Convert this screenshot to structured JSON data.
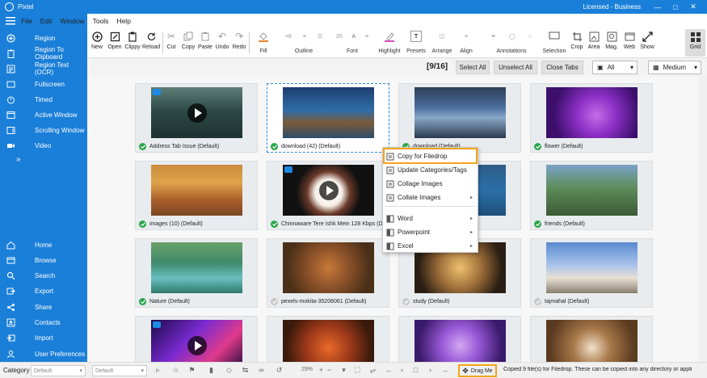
{
  "app": {
    "title": "Pixtel",
    "license": "Licensed - Business"
  },
  "colors": {
    "brand": "#1a7fd8",
    "check": "#2ba44a",
    "highlight": "#f5a31a"
  },
  "menu": [
    "File",
    "Edit",
    "Window",
    "Tools",
    "Help"
  ],
  "sidebar": {
    "capture": [
      {
        "label": "Region",
        "icon": "region-icon"
      },
      {
        "label": "Region To Clipboard",
        "icon": "clipboard-icon"
      },
      {
        "label": "Region Text (OCR)",
        "icon": "ocr-icon"
      },
      {
        "label": "Fullscreen",
        "icon": "fullscreen-icon"
      },
      {
        "label": "Timed",
        "icon": "timer-icon"
      },
      {
        "label": "Active Window",
        "icon": "window-icon"
      },
      {
        "label": "Scrolling Window",
        "icon": "scroll-window-icon"
      },
      {
        "label": "Video",
        "icon": "video-icon"
      }
    ],
    "more": "»",
    "nav": [
      {
        "label": "Home",
        "icon": "home-icon"
      },
      {
        "label": "Browse",
        "icon": "browse-icon"
      },
      {
        "label": "Search",
        "icon": "search-icon"
      },
      {
        "label": "Export",
        "icon": "export-icon"
      },
      {
        "label": "Share",
        "icon": "share-icon"
      },
      {
        "label": "Contacts",
        "icon": "contacts-icon"
      },
      {
        "label": "Import",
        "icon": "import-icon"
      },
      {
        "label": "User Preferences",
        "icon": "preferences-icon"
      }
    ]
  },
  "toolbar": {
    "buttons": [
      "New",
      "Open",
      "Clippy",
      "Reload",
      "Cut",
      "Copy",
      "Paste",
      "Undo",
      "Redo",
      "Fill",
      "Outline",
      "Font",
      "Highlight",
      "Presets",
      "Arrange",
      "Align",
      "Annotations",
      "Selection",
      "Crop",
      "Area",
      "Mag.",
      "Web",
      "Show",
      "Grid"
    ],
    "outline_value": "6",
    "font_size": "20"
  },
  "subbar": {
    "counter": "[9/16]",
    "select_all": "Select All",
    "unselect_all": "Unselect All",
    "close_tabs": "Close Tabs",
    "filter": "All",
    "size": "Medium"
  },
  "cards": [
    {
      "caption": "Address Tab Issue (Default)",
      "checked": true,
      "video": true,
      "theme": "forest"
    },
    {
      "caption": "download (42) (Default)",
      "checked": true,
      "video": false,
      "theme": "pier"
    },
    {
      "caption": "download (Default)",
      "checked": true,
      "video": false,
      "theme": "rain"
    },
    {
      "caption": "flower (Default)",
      "checked": true,
      "video": false,
      "theme": "flower"
    },
    {
      "caption": "images (10) (Default)",
      "checked": true,
      "video": false,
      "theme": "family"
    },
    {
      "caption": "Chinnaware Tere Ishk Mein 128 Kbps (Default)",
      "checked": true,
      "video": true,
      "theme": "music"
    },
    {
      "caption": "",
      "checked": true,
      "video": false,
      "theme": "ocean"
    },
    {
      "caption": "friends (Default)",
      "checked": true,
      "video": false,
      "theme": "friends"
    },
    {
      "caption": "Nature (Default)",
      "checked": true,
      "video": false,
      "theme": "waterfall"
    },
    {
      "caption": "pexels-mokita-35206061 (Default)",
      "checked": false,
      "video": false,
      "theme": "squirrel"
    },
    {
      "caption": "study (Default)",
      "checked": false,
      "video": false,
      "theme": "study"
    },
    {
      "caption": "tajmahal (Default)",
      "checked": false,
      "video": false,
      "theme": "taj"
    },
    {
      "caption": "",
      "checked": false,
      "video": true,
      "theme": "neon"
    },
    {
      "caption": "",
      "checked": false,
      "video": false,
      "theme": "fruit"
    },
    {
      "caption": "",
      "checked": false,
      "video": false,
      "theme": "butterfly"
    },
    {
      "caption": "",
      "checked": false,
      "video": false,
      "theme": "coffee"
    }
  ],
  "context_menu": [
    {
      "label": "Copy for Filedrop",
      "submenu": false
    },
    {
      "label": "Update Categories/Tags",
      "submenu": false
    },
    {
      "label": "Collage Images",
      "submenu": false
    },
    {
      "label": "Collate Images",
      "submenu": true
    },
    {
      "label": "Word",
      "submenu": true
    },
    {
      "label": "Powerpoint",
      "submenu": true
    },
    {
      "label": "Excel",
      "submenu": true
    }
  ],
  "statusbar": {
    "category_label": "Category",
    "category_value": "Default",
    "tag_value": "Default",
    "zoom": "29%",
    "drag_me": "Drag Me",
    "message": "Copied 9 file(s) for Filedrop. These can be copied into any directory or appli"
  }
}
